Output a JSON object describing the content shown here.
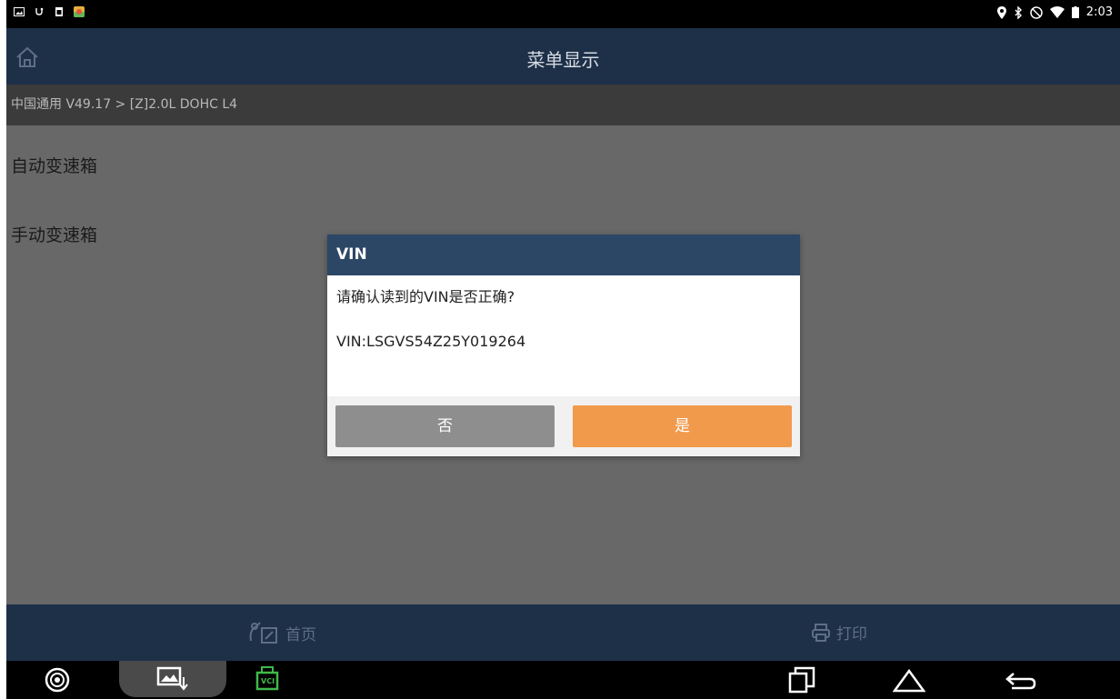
{
  "status_bar": {
    "left_icons": [
      "gallery-icon",
      "usb-icon",
      "clipboard-icon",
      "app-icon"
    ],
    "right_icons": [
      "location-icon",
      "bluetooth-icon",
      "do-not-disturb-icon",
      "wifi-icon",
      "battery-icon"
    ],
    "time": "2:03"
  },
  "header": {
    "title": "菜单显示",
    "home_icon": "home-icon"
  },
  "breadcrumb": "中国通用 V49.17 > [Z]2.0L DOHC L4",
  "menu": {
    "items": [
      {
        "label": "自动变速箱"
      },
      {
        "label": "手动变速箱"
      }
    ]
  },
  "toolbar": {
    "home_label": "首页",
    "print_label": "打印"
  },
  "navbar": {
    "icons": [
      "browser-icon",
      "screenshot-icon",
      "vci-icon",
      "recent-apps-icon",
      "android-home-icon",
      "back-icon"
    ],
    "vci_label": "VCI"
  },
  "dialog": {
    "title": "VIN",
    "question": "请确认读到的VIN是否正确?",
    "vin": "VIN:LSGVS54Z25Y019264",
    "no_label": "否",
    "yes_label": "是"
  },
  "colors": {
    "title_bar": "#1d3048",
    "dialog_header": "#2c4766",
    "yes_button": "#f19a4c",
    "no_button": "#8e8e8e"
  }
}
